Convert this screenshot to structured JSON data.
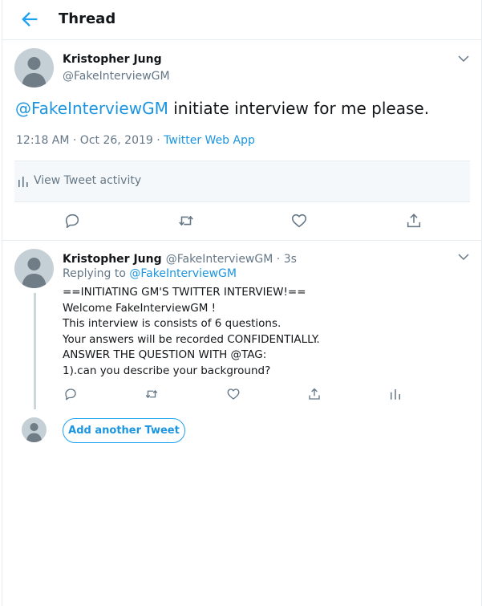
{
  "header": {
    "title": "Thread"
  },
  "main_tweet": {
    "author_name": "Kristopher Jung",
    "author_handle": "@FakeInterviewGM",
    "mention": "@FakeInterviewGM",
    "text": " initiate interview for me please.",
    "timestamp": "12:18 AM · Oct 26, 2019",
    "separator": " · ",
    "source": "Twitter Web App",
    "activity_label": "View Tweet activity"
  },
  "reply_tweet": {
    "author_name": "Kristopher Jung",
    "author_handle": "@FakeInterviewGM",
    "dot": " · ",
    "time_ago": "3s",
    "replying_prefix": "Replying to ",
    "replying_handle": "@FakeInterviewGM",
    "lines": [
      "==INITIATING GM'S TWITTER INTERVIEW!==",
      "Welcome FakeInterviewGM !",
      "This interview is consists of 6 questions.",
      "Your answers will be recorded CONFIDENTIALLY.",
      "ANSWER THE QUESTION WITH @TAG:",
      "1).can you describe your background?"
    ]
  },
  "compose": {
    "add_label": "Add another Tweet"
  },
  "colors": {
    "accent": "#1da1f2",
    "link": "#1b95e0",
    "muted": "#657786",
    "border": "#e6ecf0"
  },
  "icons": [
    "back-arrow-icon",
    "chevron-down-icon",
    "analytics-icon",
    "reply-icon",
    "retweet-icon",
    "like-icon",
    "share-icon"
  ]
}
